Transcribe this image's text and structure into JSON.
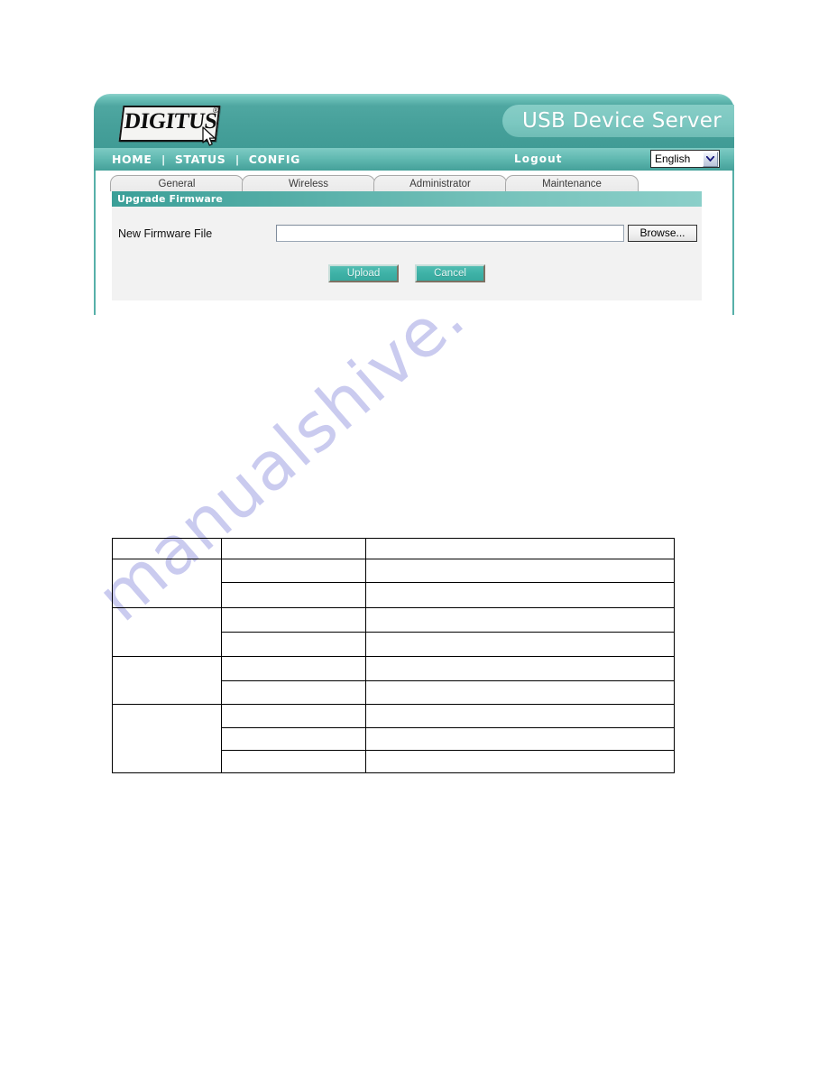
{
  "page": {
    "background_color": "#ffffff",
    "watermark_text": "manualshive.com",
    "watermark_color": "#c8c9ef"
  },
  "device_ui": {
    "brand": {
      "logo_text": "DIGITUS",
      "logo_registered_mark": "®",
      "product_title": "USB Device Server"
    },
    "theme": {
      "header_teal": "#46a09a",
      "nav_teal": "#62bab2",
      "section_bar_teal": "#3b9f98",
      "button_teal": "#3fb3a8"
    },
    "nav": {
      "links": [
        {
          "label": "HOME"
        },
        {
          "label": "STATUS"
        },
        {
          "label": "CONFIG"
        }
      ],
      "separator": "|",
      "logout_label": "Logout",
      "language": {
        "selected": "English",
        "options": [
          "English"
        ]
      }
    },
    "tabs": [
      {
        "label": "General",
        "active": false
      },
      {
        "label": "Wireless",
        "active": false
      },
      {
        "label": "Administrator",
        "active": false
      },
      {
        "label": "Maintenance",
        "active": true
      }
    ],
    "section": {
      "title": "Upgrade Firmware"
    },
    "form": {
      "field_label": "New Firmware File",
      "file_value": "",
      "file_placeholder": "",
      "browse_label": "Browse..."
    },
    "actions": {
      "upload_label": "Upload",
      "cancel_label": "Cancel"
    }
  },
  "spec_table": {
    "columns": [
      "",
      "",
      ""
    ],
    "rows": [
      {
        "group": "",
        "sub": "",
        "detail": "",
        "group_span": 1
      },
      {
        "group": "",
        "sub": "",
        "detail": "",
        "group_span": 2
      },
      {
        "group": "",
        "sub": "",
        "detail": "",
        "group_span": 0
      },
      {
        "group": "",
        "sub": "",
        "detail": "",
        "group_span": 2
      },
      {
        "group": "",
        "sub": "",
        "detail": "",
        "group_span": 0
      },
      {
        "group": "",
        "sub": "",
        "detail": "",
        "group_span": 2
      },
      {
        "group": "",
        "sub": "",
        "detail": "",
        "group_span": 0
      },
      {
        "group": "",
        "sub": "",
        "detail": "",
        "group_span": 3
      },
      {
        "group": "",
        "sub": "",
        "detail": "",
        "group_span": 0
      },
      {
        "group": "",
        "sub": "",
        "detail": "",
        "group_span": 0
      }
    ]
  }
}
